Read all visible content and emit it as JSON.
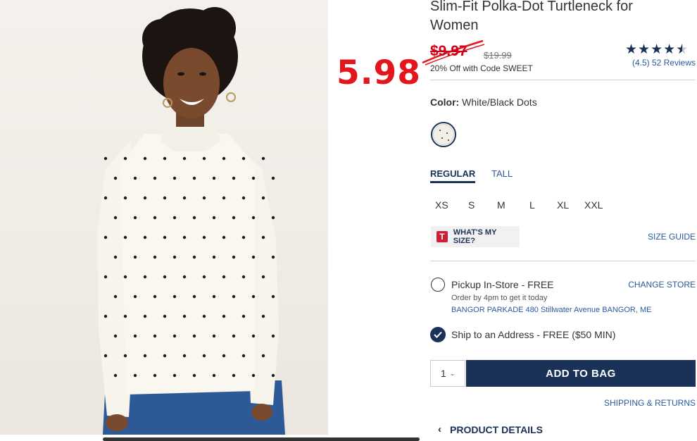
{
  "product": {
    "title": "Slim-Fit Polka-Dot Turtleneck for Women",
    "sale_price": "$9.97",
    "original_price": "$19.99",
    "promo": "20% Off with Code SWEET",
    "rating_text": "(4.5) 52 Reviews",
    "rating_value": 4.5,
    "rating_max": 5
  },
  "annotation": {
    "handwritten_price": "5.98",
    "color": "#e3161c"
  },
  "color": {
    "label": "Color:",
    "value": "White/Black Dots"
  },
  "fit_tabs": [
    {
      "label": "REGULAR",
      "active": true
    },
    {
      "label": "TALL",
      "active": false
    }
  ],
  "sizes": [
    "XS",
    "S",
    "M",
    "L",
    "XL",
    "XXL"
  ],
  "size_help": {
    "icon_letter": "T",
    "whats_my_size": "WHAT'S MY SIZE?",
    "size_guide": "SIZE GUIDE"
  },
  "fulfillment": {
    "pickup_label": "Pickup In-Store - FREE",
    "change_store": "CHANGE STORE",
    "pickup_sub": "Order by 4pm to get it today",
    "pickup_address": "BANGOR PARKADE 480 Stillwater Avenue  BANGOR, ME",
    "ship_label": "Ship to an Address - FREE ($50 MIN)",
    "selected": "ship"
  },
  "cart": {
    "quantity": "1",
    "add_to_bag": "ADD TO BAG",
    "shipping_returns": "SHIPPING & RETURNS"
  },
  "details": {
    "label": "PRODUCT DETAILS"
  },
  "colors": {
    "brand_navy": "#1a3158",
    "link_blue": "#2b5a9c",
    "sale_red": "#d0011b"
  }
}
